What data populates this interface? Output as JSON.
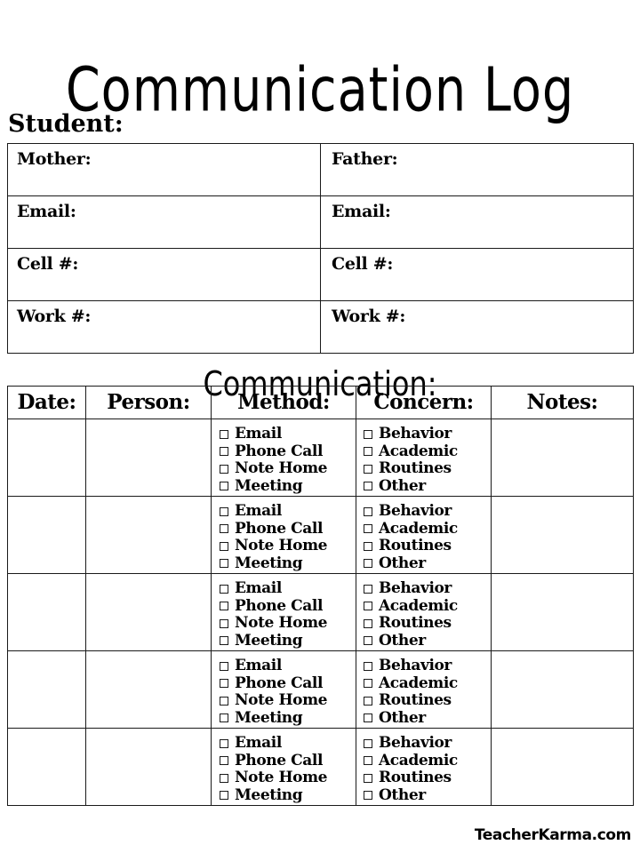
{
  "document": {
    "title": "Communication Log",
    "student_label": "Student:",
    "section_heading": "Communication:",
    "footer_brand": "TeacherKarma.com"
  },
  "contact_table": {
    "rows": [
      {
        "left": "Mother:",
        "right": "Father:"
      },
      {
        "left": "Email:",
        "right": "Email:"
      },
      {
        "left": "Cell #:",
        "right": "Cell #:"
      },
      {
        "left": "Work #:",
        "right": "Work #:"
      }
    ]
  },
  "log_table": {
    "headers": [
      "Date:",
      "Person:",
      "Method:",
      "Concern:",
      "Notes:"
    ],
    "method_options": [
      "Email",
      "Phone Call",
      "Note Home",
      "Meeting"
    ],
    "concern_options": [
      "Behavior",
      "Academic",
      "Routines",
      "Other"
    ],
    "row_count": 5
  },
  "colors": {
    "page_background": "#ffffff",
    "ink": "#000000",
    "border": "#1a1a1a"
  }
}
